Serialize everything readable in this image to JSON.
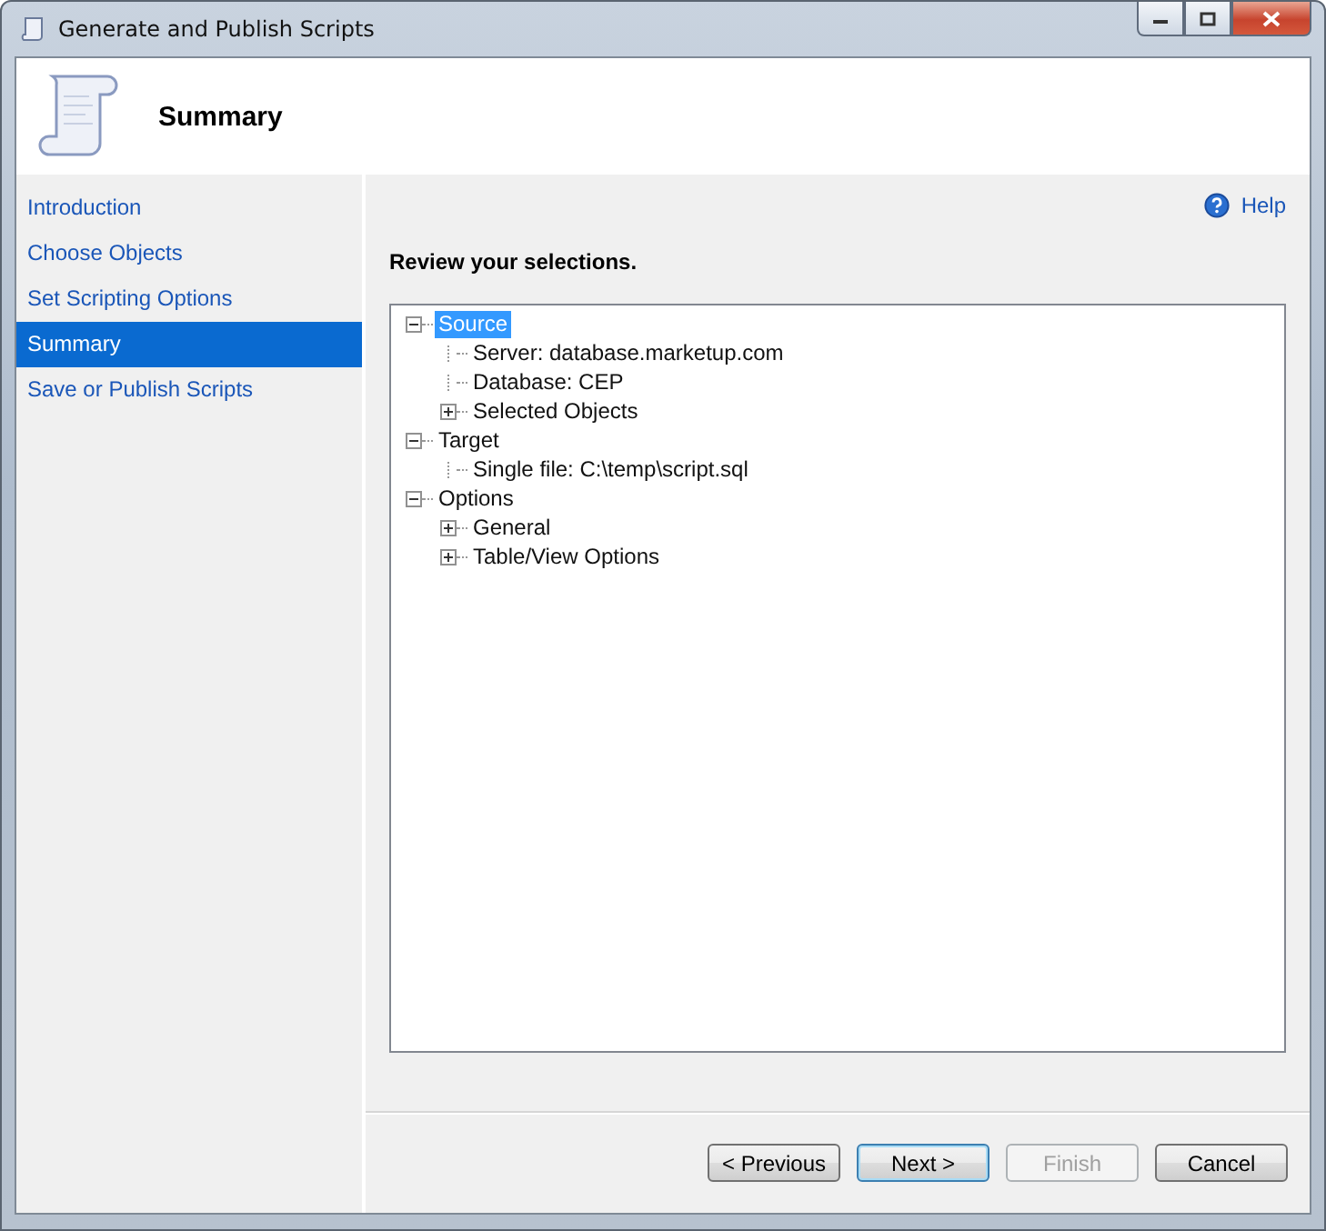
{
  "window": {
    "title": "Generate and Publish Scripts"
  },
  "header": {
    "title": "Summary"
  },
  "sidebar": {
    "items": [
      {
        "label": "Introduction",
        "selected": false
      },
      {
        "label": "Choose Objects",
        "selected": false
      },
      {
        "label": "Set Scripting Options",
        "selected": false
      },
      {
        "label": "Summary",
        "selected": true
      },
      {
        "label": "Save or Publish Scripts",
        "selected": false
      }
    ]
  },
  "help_link": "Help",
  "instruction": "Review your selections.",
  "tree": [
    {
      "label": "Source",
      "expanded": true,
      "selected": true,
      "children": [
        {
          "label": "Server: database.marketup.com",
          "selected": false
        },
        {
          "label": "Database: CEP",
          "selected": false
        },
        {
          "label": "Selected Objects",
          "expanded": false,
          "selected": false
        }
      ]
    },
    {
      "label": "Target",
      "expanded": true,
      "selected": false,
      "children": [
        {
          "label": "Single file: C:\\temp\\script.sql",
          "selected": false
        }
      ]
    },
    {
      "label": "Options",
      "expanded": true,
      "selected": false,
      "children": [
        {
          "label": "General",
          "expanded": false,
          "selected": false
        },
        {
          "label": "Table/View Options",
          "expanded": false,
          "selected": false
        }
      ]
    }
  ],
  "buttons": [
    {
      "label": "< Previous",
      "disabled": false,
      "default": false
    },
    {
      "label": "Next >",
      "disabled": false,
      "default": true
    },
    {
      "label": "Finish",
      "disabled": true,
      "default": false
    },
    {
      "label": "Cancel",
      "disabled": false,
      "default": false
    }
  ]
}
